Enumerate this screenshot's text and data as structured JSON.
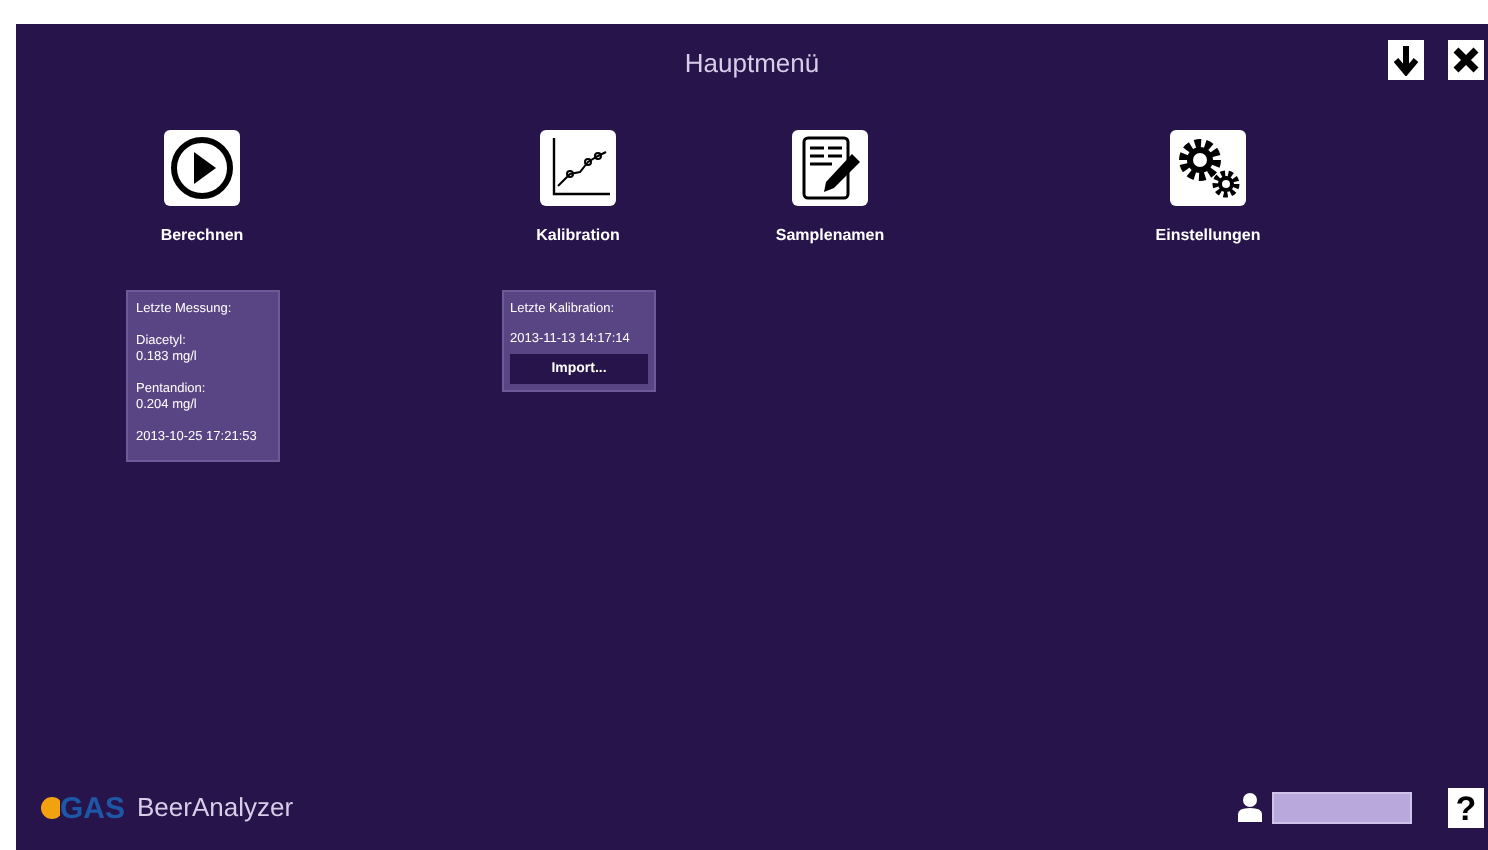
{
  "window": {
    "title": "Hauptmenü"
  },
  "tiles": [
    {
      "kind": "play",
      "label": "Berechnen"
    },
    {
      "kind": "chart",
      "label": "Kalibration"
    },
    {
      "kind": "notes",
      "label": "Samplenamen"
    },
    {
      "kind": "gears",
      "label": "Einstellungen"
    }
  ],
  "measurement_card": {
    "heading": "Letzte Messung:",
    "results": [
      {
        "name": "Diacetyl:",
        "value": "0.183 mg/l"
      },
      {
        "name": "Pentandion:",
        "value": "0.204 mg/l"
      }
    ],
    "timestamp": "2013-10-25 17:21:53"
  },
  "calibration_card": {
    "heading": "Letzte Kalibration:",
    "timestamp": "2013-11-13 14:17:14",
    "button": "Import..."
  },
  "footer": {
    "brand_mark": "GAS",
    "app_name": "BeerAnalyzer",
    "help": "?"
  }
}
